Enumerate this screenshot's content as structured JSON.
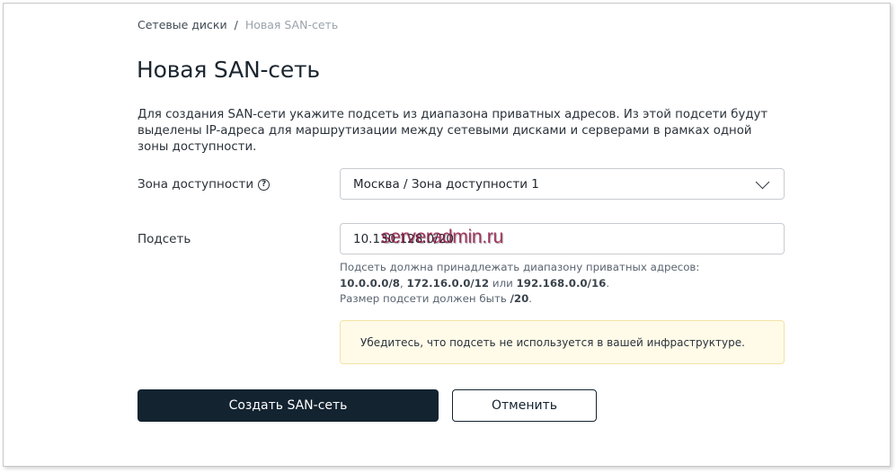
{
  "breadcrumb": {
    "parent": "Сетевые диски",
    "separator": "/",
    "current": "Новая SAN-сеть"
  },
  "page": {
    "title": "Новая SAN-сеть",
    "description": "Для создания SAN-сети укажите подсеть из диапазона приватных адресов. Из этой подсети будут выделены IP-адреса для маршрутизации между сетевыми дисками и серверами в рамках одной зоны доступности."
  },
  "form": {
    "zone": {
      "label": "Зона доступности",
      "help_icon": "question-circle-icon",
      "value": "Москва / Зона доступности 1",
      "dropdown_icon": "chevron-down-icon"
    },
    "subnet": {
      "label": "Подсеть",
      "value": "10.130.128.0/20",
      "hint_line1": "Подсеть должна принадлежать диапазону приватных адресов:",
      "hint_range1": "10.0.0.0/8",
      "hint_comma": ", ",
      "hint_range2": "172.16.0.0/12",
      "hint_or": " или ",
      "hint_range3": "192.168.0.0/16",
      "hint_period": ".",
      "hint_line3": "Размер подсети должен быть ",
      "hint_size": "/20",
      "hint_period2": "."
    },
    "warning": "Убедитесь, что подсеть не используется в вашей инфраструктуре."
  },
  "watermark": "serveradmin.ru",
  "actions": {
    "create_label": "Создать SAN-сеть",
    "cancel_label": "Отменить"
  }
}
